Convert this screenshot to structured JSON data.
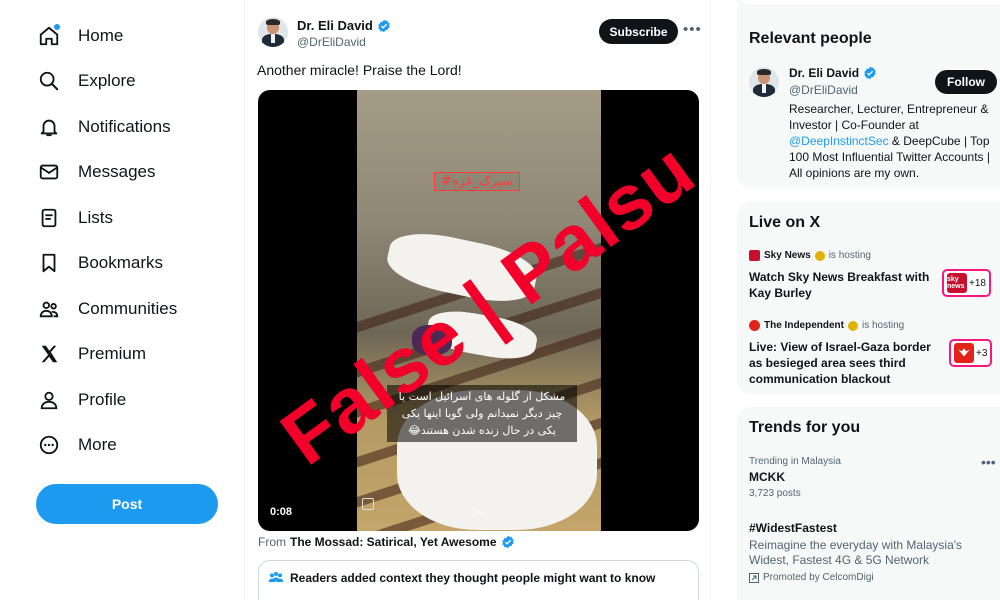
{
  "nav": {
    "items": [
      {
        "label": "Home",
        "icon": "home-icon"
      },
      {
        "label": "Explore",
        "icon": "search-icon"
      },
      {
        "label": "Notifications",
        "icon": "bell-icon"
      },
      {
        "label": "Messages",
        "icon": "mail-icon"
      },
      {
        "label": "Lists",
        "icon": "list-icon"
      },
      {
        "label": "Bookmarks",
        "icon": "bookmark-icon"
      },
      {
        "label": "Communities",
        "icon": "people-icon"
      },
      {
        "label": "Premium",
        "icon": "x-logo-icon"
      },
      {
        "label": "Profile",
        "icon": "person-icon"
      },
      {
        "label": "More",
        "icon": "more-circle-icon"
      }
    ],
    "post_label": "Post"
  },
  "tweet": {
    "author_name": "Dr. Eli David",
    "author_handle": "@DrEliDavid",
    "subscribe_label": "Subscribe",
    "text": "Another miracle! Praise the Lord!",
    "video": {
      "tag_text": "#سیرک_غزه",
      "caption": "مشکل از گلوله های اسرائیل است یا چیز دیگر نمیدانم ولی گویا اینها یکی یکی در حال زنده شدن هستند😂",
      "timecode": "0:08"
    },
    "from_prefix": "From",
    "from_source": "The Mossad: Satirical, Yet Awesome",
    "context_label": "Readers added context they thought people might want to know"
  },
  "relevant": {
    "title": "Relevant people",
    "name": "Dr. Eli David",
    "handle": "@DrEliDavid",
    "follow_label": "Follow",
    "bio_1": "Researcher, Lecturer, Entrepreneur & Investor | Co-Founder at ",
    "bio_mention": "@DeepInstinctSec",
    "bio_2": " & DeepCube | Top 100 Most Influential Twitter Accounts | All opinions are my own."
  },
  "live": {
    "title": "Live on X",
    "items": [
      {
        "host": "Sky News",
        "hosting": "is hosting",
        "title": "Watch Sky News Breakfast with Kay Burley",
        "count": "+18",
        "thumb": "sky news"
      },
      {
        "host": "The Independent",
        "hosting": "is hosting",
        "title": "Live: View of Israel-Gaza border as besieged area sees third communication blackout",
        "count": "+3"
      }
    ]
  },
  "trends": {
    "title": "Trends for you",
    "items": [
      {
        "meta": "Trending in Malaysia",
        "name": "MCKK",
        "posts": "3,723 posts"
      },
      {
        "name": "#WidestFastest",
        "desc": "Reimagine the everyday with Malaysia's Widest, Fastest 4G & 5G Network",
        "promoted": "Promoted by CelcomDigi"
      }
    ]
  },
  "overlay": {
    "stamp_text": "False | Palsu"
  },
  "colors": {
    "accent": "#1d9bf0",
    "stamp": "#f2002a",
    "live_border": "#f91880"
  }
}
